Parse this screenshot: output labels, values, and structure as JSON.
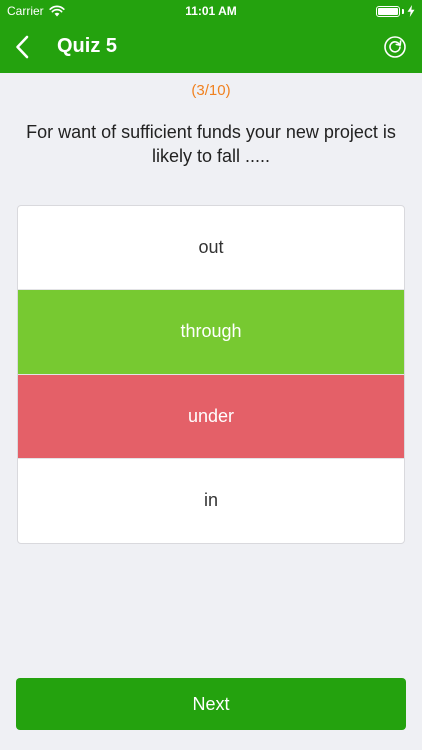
{
  "status_bar": {
    "carrier": "Carrier",
    "time": "11:01 AM",
    "battery_level": 1.0
  },
  "nav": {
    "title": "Quiz 5",
    "back_icon": "chevron-left-icon",
    "reset_icon": "refresh-icon"
  },
  "quiz": {
    "progress": "(3/10)",
    "question": "For want of sufficient funds your new project is likely to fall .....",
    "options": [
      {
        "label": "out",
        "state": "neutral"
      },
      {
        "label": "through",
        "state": "correct"
      },
      {
        "label": "under",
        "state": "wrong"
      },
      {
        "label": "in",
        "state": "neutral"
      }
    ]
  },
  "footer": {
    "next_label": "Next"
  },
  "colors": {
    "brand_green": "#24a20e",
    "correct": "#77c931",
    "wrong": "#e46068",
    "counter": "#f0811f",
    "background": "#eff0f4"
  }
}
